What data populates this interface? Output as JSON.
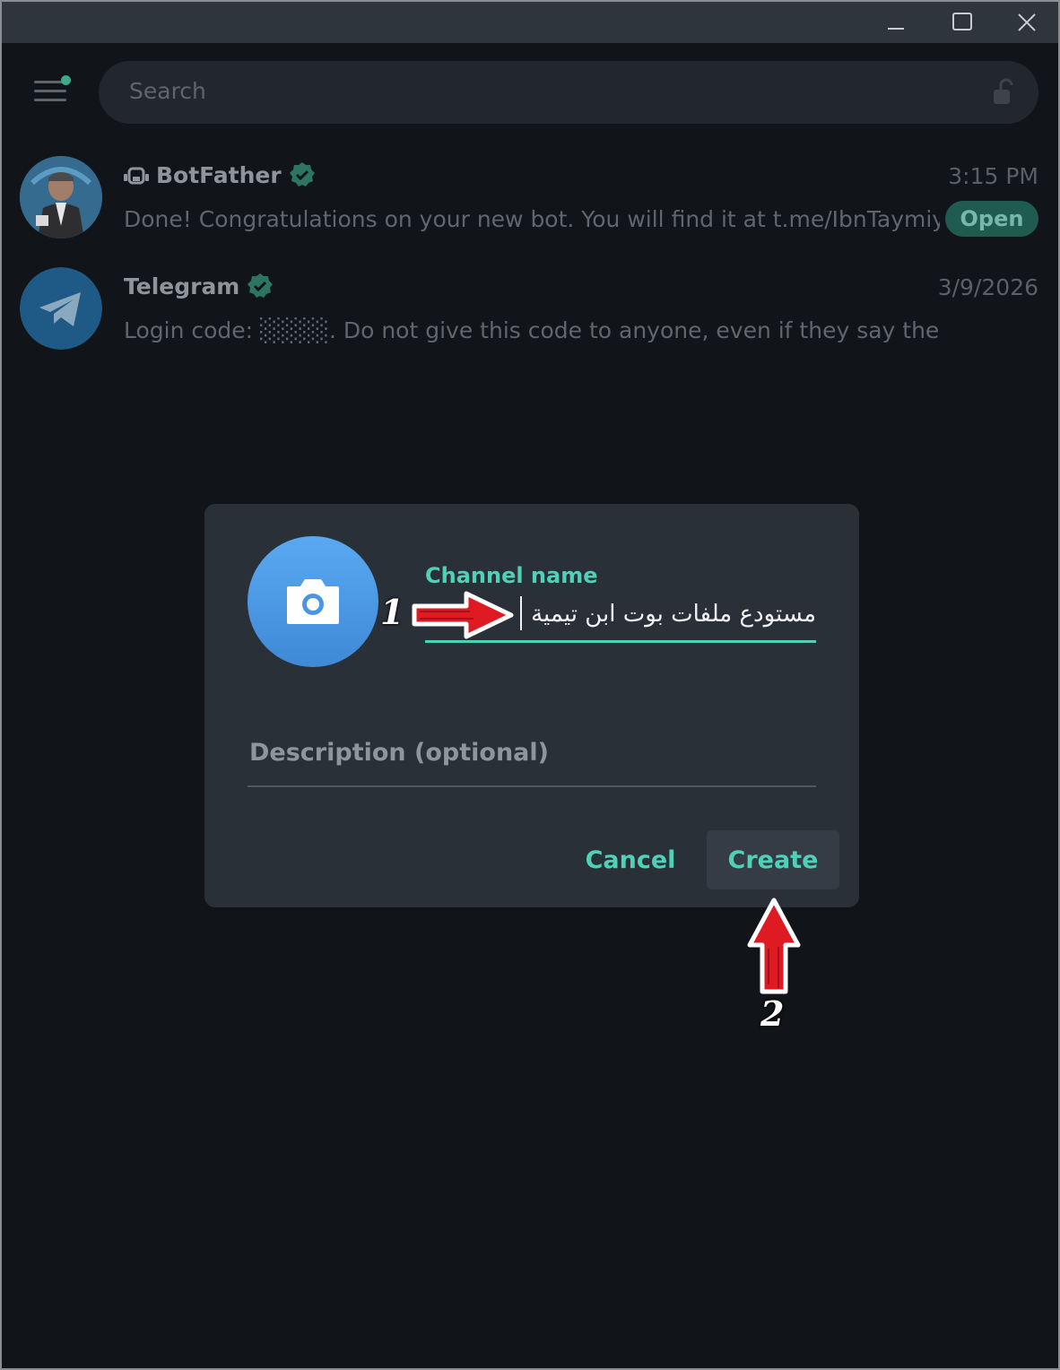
{
  "window": {
    "controls": [
      "minimize",
      "maximize",
      "close"
    ]
  },
  "search": {
    "placeholder": "Search"
  },
  "chats": [
    {
      "name": "BotFather",
      "time": "3:15 PM",
      "preview": "Done! Congratulations on your new bot. You will find it at t.me/IbnTaymiy...",
      "badge": "Open",
      "verified": true,
      "icon": "bot-icon"
    },
    {
      "name": "Telegram",
      "time": "3/9/2026",
      "preview": "Login code: ░░░░. Do not give this code to anyone, even if they say they are from...",
      "verified": true
    }
  ],
  "dialog": {
    "channel_name_label": "Channel name",
    "channel_name_value": "مستودع ملفات بوت ابن تيمية",
    "description_placeholder": "Description (optional)",
    "cancel_label": "Cancel",
    "create_label": "Create",
    "photo_icon": "camera-icon"
  },
  "annotations": {
    "step1": "1",
    "step2": "2"
  },
  "colors": {
    "accent": "#4fd1b8",
    "dialog_bg": "#2a3038",
    "app_bg": "#111418",
    "photo_blue": "#4a96e4",
    "arrow_red": "#e01a23"
  }
}
